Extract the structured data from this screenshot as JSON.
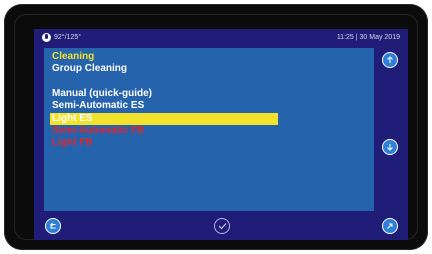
{
  "status": {
    "temperature": "92°/125°",
    "datetime": "11:25 | 30 May 2019"
  },
  "menu": {
    "section_title": "Cleaning",
    "subtitle": "Group Cleaning",
    "items": [
      {
        "label": "Manual (quick-guide)",
        "state": "normal"
      },
      {
        "label": "Semi-Automatic ES",
        "state": "normal"
      },
      {
        "label": "Light ES",
        "state": "selected"
      },
      {
        "label": "Semi-Automatic FB",
        "state": "disabled"
      },
      {
        "label": "Light FB",
        "state": "disabled"
      }
    ]
  },
  "buttons": {
    "scroll_up": "arrow-up-icon",
    "scroll_down": "arrow-down-icon",
    "back": "back-icon",
    "confirm": "check-icon",
    "forward": "forward-icon"
  },
  "colors": {
    "screen_bg": "#1f1d78",
    "content_bg": "#2563ad",
    "highlight": "#f3e22b",
    "disabled_text": "#e0262c",
    "button_fill": "#2e7fd6"
  }
}
